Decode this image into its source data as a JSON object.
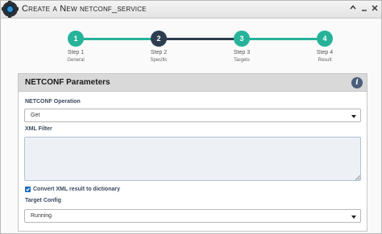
{
  "window": {
    "title": "Create a New netconf_service",
    "icon": "gear-icon"
  },
  "stepper": {
    "steps": [
      {
        "number": "1",
        "name": "Step 1",
        "sublabel": "General",
        "state": "done"
      },
      {
        "number": "2",
        "name": "Step 2",
        "sublabel": "Specific",
        "state": "active"
      },
      {
        "number": "3",
        "name": "Step 3",
        "sublabel": "Targets",
        "state": "done"
      },
      {
        "number": "4",
        "name": "Step 4",
        "sublabel": "Result",
        "state": "done"
      }
    ],
    "colors": {
      "done": "#26b39a",
      "active": "#2c3e50"
    }
  },
  "panel": {
    "title": "NETCONF Parameters",
    "info_symbol": "i",
    "operation": {
      "label": "NETCONF Operation",
      "value": "Get"
    },
    "xml_filter": {
      "label": "XML Filter",
      "value": ""
    },
    "convert": {
      "label": "Convert XML result to dictionary",
      "checked": true
    },
    "target_config": {
      "label": "Target Config",
      "value": "Running"
    }
  }
}
